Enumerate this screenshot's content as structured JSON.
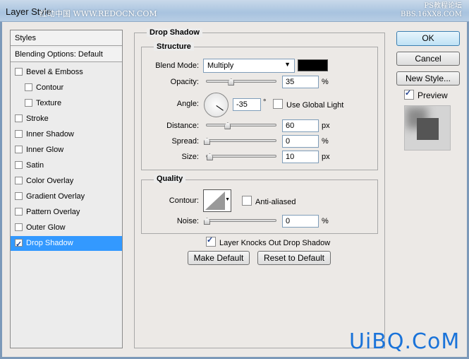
{
  "window": {
    "title": "Layer Style",
    "watermark_left": "红动中国 WWW.REDOCN.COM",
    "watermark_right_1": "PS教程论坛",
    "watermark_right_2": "BBS.16XX8.COM",
    "watermark_bottom": "UiBQ.CoM"
  },
  "sidebar": {
    "styles_label": "Styles",
    "blending_label": "Blending Options: Default",
    "items": [
      {
        "label": "Bevel & Emboss",
        "checked": false,
        "indent": false
      },
      {
        "label": "Contour",
        "checked": false,
        "indent": true
      },
      {
        "label": "Texture",
        "checked": false,
        "indent": true
      },
      {
        "label": "Stroke",
        "checked": false,
        "indent": false
      },
      {
        "label": "Inner Shadow",
        "checked": false,
        "indent": false
      },
      {
        "label": "Inner Glow",
        "checked": false,
        "indent": false
      },
      {
        "label": "Satin",
        "checked": false,
        "indent": false
      },
      {
        "label": "Color Overlay",
        "checked": false,
        "indent": false
      },
      {
        "label": "Gradient Overlay",
        "checked": false,
        "indent": false
      },
      {
        "label": "Pattern Overlay",
        "checked": false,
        "indent": false
      },
      {
        "label": "Outer Glow",
        "checked": false,
        "indent": false
      },
      {
        "label": "Drop Shadow",
        "checked": true,
        "indent": false,
        "selected": true
      }
    ]
  },
  "main": {
    "title": "Drop Shadow",
    "structure": {
      "title": "Structure",
      "blend_mode_label": "Blend Mode:",
      "blend_mode": "Multiply",
      "shadow_color": "#000000",
      "opacity_label": "Opacity:",
      "opacity": "35",
      "opacity_unit": "%",
      "angle_label": "Angle:",
      "angle": "-35",
      "angle_unit": "°",
      "global_light_label": "Use Global Light",
      "global_light": false,
      "distance_label": "Distance:",
      "distance": "60",
      "distance_unit": "px",
      "spread_label": "Spread:",
      "spread": "0",
      "spread_unit": "%",
      "size_label": "Size:",
      "size": "10",
      "size_unit": "px"
    },
    "quality": {
      "title": "Quality",
      "contour_label": "Contour:",
      "anti_aliased_label": "Anti-aliased",
      "anti_aliased": false,
      "noise_label": "Noise:",
      "noise": "0",
      "noise_unit": "%"
    },
    "knockout_label": "Layer Knocks Out Drop Shadow",
    "knockout": true,
    "make_default": "Make Default",
    "reset_default": "Reset to Default"
  },
  "buttons": {
    "ok": "OK",
    "cancel": "Cancel",
    "new_style": "New Style...",
    "preview_label": "Preview",
    "preview": true
  },
  "sliders": {
    "opacity_pct": 35,
    "distance_pct": 30,
    "spread_pct": 0,
    "size_pct": 4,
    "noise_pct": 0
  }
}
